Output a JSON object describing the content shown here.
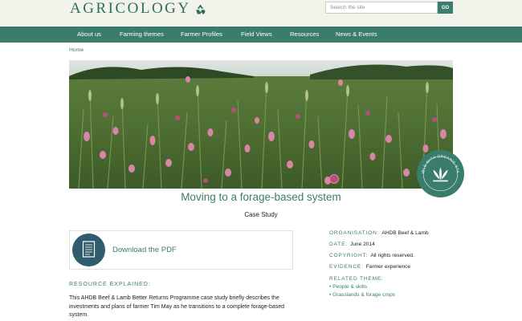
{
  "header": {
    "logo_text": "AGRICOLOGY",
    "search_placeholder": "Search the site",
    "search_button": "GO"
  },
  "nav": {
    "items": [
      "About us",
      "Farming themes",
      "Farmer Profiles",
      "Field Views",
      "Resources",
      "News & Events"
    ]
  },
  "breadcrumb": "Home",
  "hero": {
    "badge_text": "COMPATIBLE WITH ORGANIC STANDARDS"
  },
  "page": {
    "title": "Moving to a forage-based system",
    "subtitle": "Case Study"
  },
  "download": {
    "label": "Download the PDF"
  },
  "resource": {
    "heading": "RESOURCE EXPLAINED:",
    "description": "This AHDB Beef & Lamb Better Returns Programme case study briefly describes the investments and plans of farmer Tim May as he transitions to a complete forage-based system."
  },
  "meta": {
    "organisation_label": "ORGANISATION:",
    "organisation": "AHDB Beef & Lamb",
    "date_label": "DATE:",
    "date": "June 2014",
    "copyright_label": "COPYRIGHT:",
    "copyright": "All rights reserved.",
    "evidence_label": "EVIDENCE:",
    "evidence": "Farmer experience"
  },
  "related": {
    "heading": "RELATED THEME:",
    "items": [
      "People & skills",
      "Grasslands & forage crops"
    ]
  },
  "colors": {
    "brand_green": "#3a7d6c",
    "header_bg": "#f2f4ec",
    "pdf_icon_bg": "#2f5d6e"
  }
}
